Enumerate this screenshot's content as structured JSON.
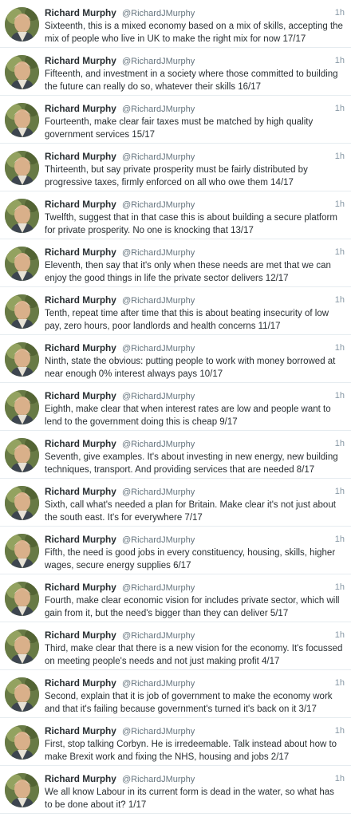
{
  "tweets": [
    {
      "name": "Richard Murphy",
      "handle": "@RichardJMurphy",
      "time": "1h",
      "text": "Sixteenth, this is a mixed economy based on a mix of skills, accepting the mix of people who live in UK to make the right mix for now 17/17"
    },
    {
      "name": "Richard Murphy",
      "handle": "@RichardJMurphy",
      "time": "1h",
      "text": "Fifteenth, and investment in a society where those committed to building the future can really do so, whatever their skills 16/17"
    },
    {
      "name": "Richard Murphy",
      "handle": "@RichardJMurphy",
      "time": "1h",
      "text": "Fourteenth, make clear fair taxes must be matched by high quality government services 15/17"
    },
    {
      "name": "Richard Murphy",
      "handle": "@RichardJMurphy",
      "time": "1h",
      "text": "Thirteenth, but say private prosperity must be fairly distributed by progressive taxes, firmly enforced on all who owe them 14/17"
    },
    {
      "name": "Richard Murphy",
      "handle": "@RichardJMurphy",
      "time": "1h",
      "text": "Twelfth, suggest that in that case this is about building a secure platform for private prosperity. No one is knocking that 13/17"
    },
    {
      "name": "Richard Murphy",
      "handle": "@RichardJMurphy",
      "time": "1h",
      "text": "Eleventh, then say that it's only when these needs are met that we can enjoy the good things in life the private sector delivers 12/17"
    },
    {
      "name": "Richard Murphy",
      "handle": "@RichardJMurphy",
      "time": "1h",
      "text": "Tenth, repeat time after time that this is about beating  insecurity of low pay, zero hours, poor landlords and health concerns 11/17"
    },
    {
      "name": "Richard Murphy",
      "handle": "@RichardJMurphy",
      "time": "1h",
      "text": "Ninth, state the obvious: putting people to work with money borrowed at near enough 0% interest always pays 10/17"
    },
    {
      "name": "Richard Murphy",
      "handle": "@RichardJMurphy",
      "time": "1h",
      "text": "Eighth, make clear that when interest rates are low and people want to lend to the government doing this is cheap 9/17"
    },
    {
      "name": "Richard Murphy",
      "handle": "@RichardJMurphy",
      "time": "1h",
      "text": "Seventh, give examples. It's about investing in new energy, new building techniques, transport. And providing services that are needed 8/17"
    },
    {
      "name": "Richard Murphy",
      "handle": "@RichardJMurphy",
      "time": "1h",
      "text": "Sixth, call what's needed a plan for Britain. Make clear it's not just about the south east. It's for everywhere 7/17"
    },
    {
      "name": "Richard Murphy",
      "handle": "@RichardJMurphy",
      "time": "1h",
      "text": "Fifth, the need is good jobs in every constituency, housing, skills, higher wages, secure energy supplies 6/17"
    },
    {
      "name": "Richard Murphy",
      "handle": "@RichardJMurphy",
      "time": "1h",
      "text": "Fourth, make clear economic vision for includes private sector, which will gain from it, but the need's bigger than they can deliver 5/17"
    },
    {
      "name": "Richard Murphy",
      "handle": "@RichardJMurphy",
      "time": "1h",
      "text": "Third, make clear that there is a new vision for the economy. It's focussed on meeting people's needs and not just making profit 4/17"
    },
    {
      "name": "Richard Murphy",
      "handle": "@RichardJMurphy",
      "time": "1h",
      "text": "Second, explain that it is job of government to make the economy work and that it's failing because government's turned it's back on it 3/17"
    },
    {
      "name": "Richard Murphy",
      "handle": "@RichardJMurphy",
      "time": "1h",
      "text": "First, stop talking Corbyn. He is irredeemable. Talk instead about how to make Brexit work and fixing the NHS, housing and jobs 2/17"
    },
    {
      "name": "Richard Murphy",
      "handle": "@RichardJMurphy",
      "time": "1h",
      "text": "We all know Labour in its current form is dead in the water, so what has to be done about it? 1/17"
    }
  ]
}
